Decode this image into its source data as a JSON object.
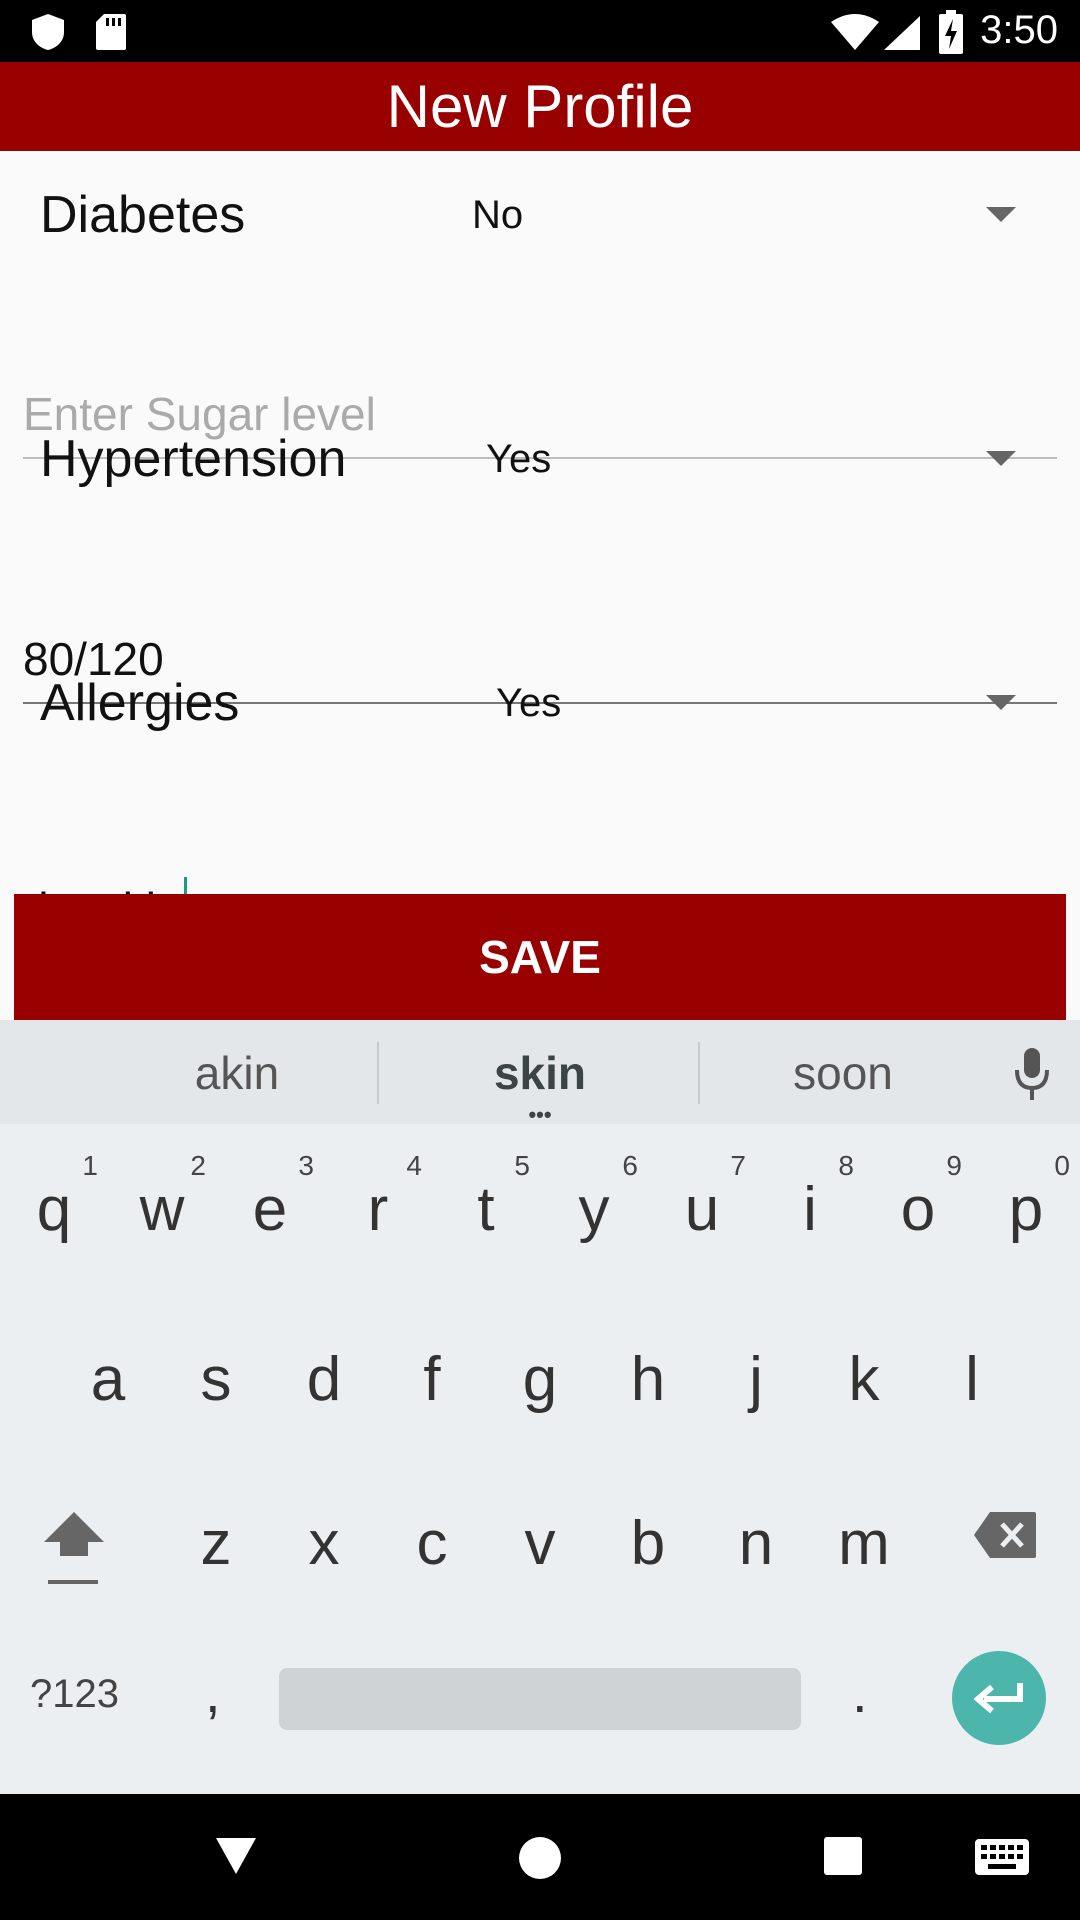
{
  "status_bar": {
    "time": "3:50"
  },
  "app_bar": {
    "title": "New Profile"
  },
  "form": {
    "diabetes": {
      "label": "Diabetes",
      "value": "No"
    },
    "sugar_level": {
      "value": "",
      "placeholder": "Enter Sugar level"
    },
    "hypertension": {
      "label": "Hypertension",
      "value": "Yes"
    },
    "blood_pressure": {
      "value": "80/120"
    },
    "allergies": {
      "label": "Allergies",
      "value": "Yes"
    },
    "allergy_details": {
      "value_plain": "dry ",
      "value_composing": "skin"
    }
  },
  "save_button": {
    "label": "SAVE"
  },
  "keyboard": {
    "suggestions": [
      "akin",
      "skin",
      "soon"
    ],
    "row1": [
      {
        "ch": "q",
        "num": "1"
      },
      {
        "ch": "w",
        "num": "2"
      },
      {
        "ch": "e",
        "num": "3"
      },
      {
        "ch": "r",
        "num": "4"
      },
      {
        "ch": "t",
        "num": "5"
      },
      {
        "ch": "y",
        "num": "6"
      },
      {
        "ch": "u",
        "num": "7"
      },
      {
        "ch": "i",
        "num": "8"
      },
      {
        "ch": "o",
        "num": "9"
      },
      {
        "ch": "p",
        "num": "0"
      }
    ],
    "row2": [
      "a",
      "s",
      "d",
      "f",
      "g",
      "h",
      "j",
      "k",
      "l"
    ],
    "row3": [
      "z",
      "x",
      "c",
      "v",
      "b",
      "n",
      "m"
    ],
    "symbols_label": "?123",
    "comma": ",",
    "period": "."
  },
  "colors": {
    "primary": "#990000",
    "accent": "#1e988a",
    "enter_key": "#4db6ac",
    "keyboard_bg": "#eceff1"
  },
  "icons": [
    "shield-icon",
    "sd-card-icon",
    "wifi-icon",
    "signal-icon",
    "battery-charging-icon",
    "dropdown-arrow-icon",
    "mic-icon",
    "shift-icon",
    "backspace-icon",
    "enter-icon",
    "nav-back-icon",
    "nav-home-icon",
    "nav-recents-icon",
    "keyboard-switch-icon"
  ]
}
